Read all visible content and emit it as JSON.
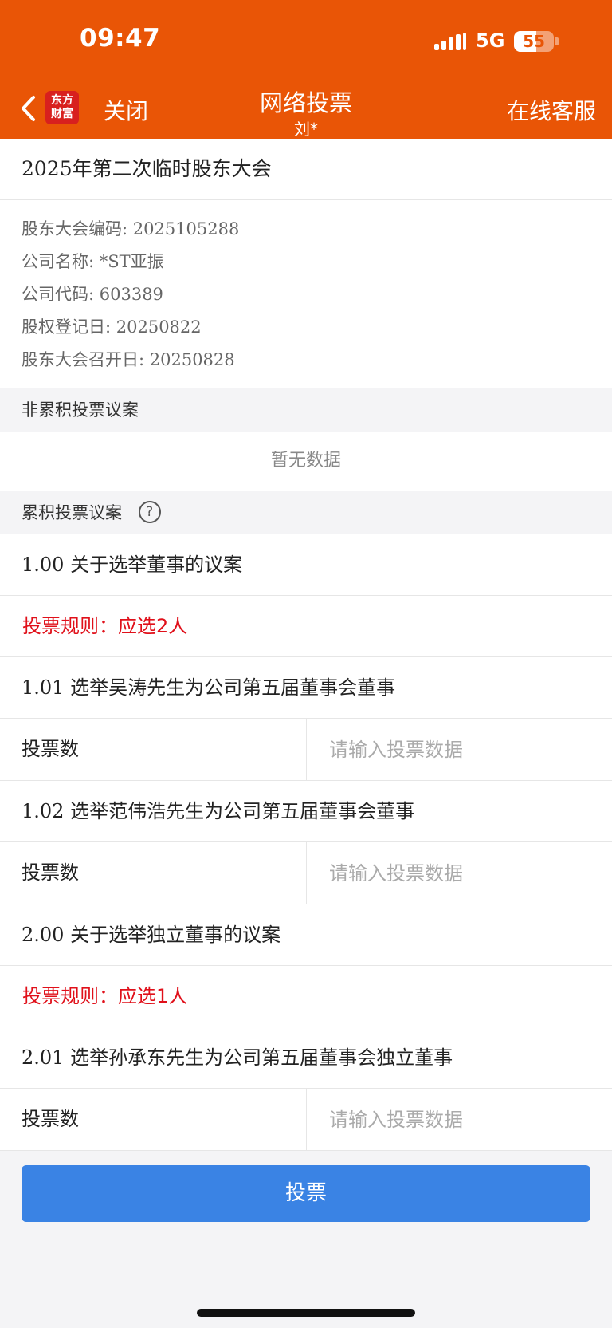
{
  "status_bar": {
    "time": "09:47",
    "network": "5G",
    "battery": "55",
    "battery_level": 0.55
  },
  "nav": {
    "close_label": "关闭",
    "title": "网络投票",
    "subtitle": "刘*",
    "service_label": "在线客服",
    "logo_line1": "东方",
    "logo_line2": "财富"
  },
  "meeting": {
    "title": "2025年第二次临时股东大会",
    "info": [
      "股东大会编码: 2025105288",
      "公司名称: *ST亚振",
      "公司代码: 603389",
      "股权登记日: 20250822",
      "股东大会召开日: 20250828"
    ]
  },
  "non_cumulative": {
    "header": "非累积投票议案",
    "empty_text": "暂无数据"
  },
  "cumulative": {
    "header": "累积投票议案",
    "help_glyph": "?",
    "proposals": [
      {
        "title": "1.00 关于选举董事的议案",
        "rule": "投票规则：应选2人",
        "candidates": [
          {
            "title": "1.01 选举吴涛先生为公司第五届董事会董事",
            "vote_label": "投票数",
            "placeholder": "请输入投票数据"
          },
          {
            "title": "1.02 选举范伟浩先生为公司第五届董事会董事",
            "vote_label": "投票数",
            "placeholder": "请输入投票数据"
          }
        ]
      },
      {
        "title": "2.00 关于选举独立董事的议案",
        "rule": "投票规则：应选1人",
        "candidates": [
          {
            "title": "2.01 选举孙承东先生为公司第五届董事会独立董事",
            "vote_label": "投票数",
            "placeholder": "请输入投票数据"
          }
        ]
      }
    ]
  },
  "submit_label": "投票",
  "colors": {
    "header_bg": "#e95506",
    "rule_red": "#e0101a",
    "button_blue": "#3a83e4"
  }
}
